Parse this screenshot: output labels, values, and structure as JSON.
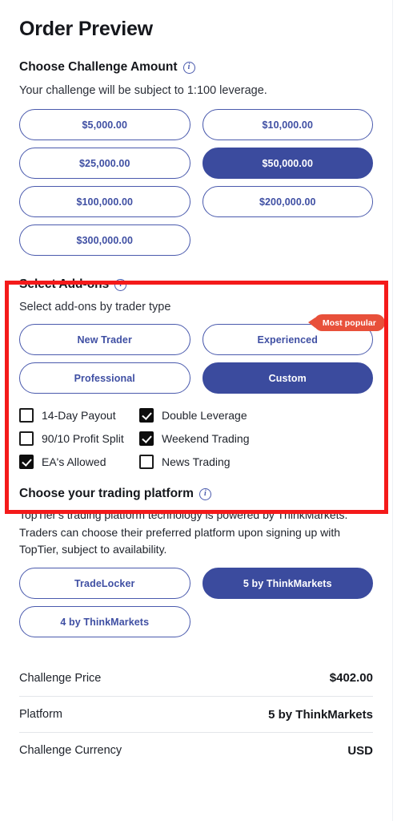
{
  "page": {
    "title": "Order Preview"
  },
  "challenge_amount": {
    "heading": "Choose Challenge Amount",
    "info_icon": "info-icon",
    "subtitle": "Your challenge will be subject to 1:100 leverage.",
    "options": [
      {
        "label": "$5,000.00",
        "selected": false
      },
      {
        "label": "$10,000.00",
        "selected": false
      },
      {
        "label": "$25,000.00",
        "selected": false
      },
      {
        "label": "$50,000.00",
        "selected": true
      },
      {
        "label": "$100,000.00",
        "selected": false
      },
      {
        "label": "$200,000.00",
        "selected": false
      },
      {
        "label": "$300,000.00",
        "selected": false
      }
    ]
  },
  "addons": {
    "heading": "Select Add-ons",
    "info_icon": "info-icon",
    "subtitle": "Select add-ons by trader type",
    "badge_label": "Most popular",
    "trader_types": [
      {
        "label": "New Trader",
        "selected": false,
        "badge": false
      },
      {
        "label": "Experienced",
        "selected": false,
        "badge": true
      },
      {
        "label": "Professional",
        "selected": false,
        "badge": false
      },
      {
        "label": "Custom",
        "selected": true,
        "badge": false
      }
    ],
    "checkboxes": [
      {
        "label": "14-Day Payout",
        "checked": false
      },
      {
        "label": "Double Leverage",
        "checked": true
      },
      {
        "label": "90/10 Profit Split",
        "checked": false
      },
      {
        "label": "Weekend Trading",
        "checked": true
      },
      {
        "label": "EA's Allowed",
        "checked": true
      },
      {
        "label": "News Trading",
        "checked": false
      }
    ]
  },
  "platform": {
    "heading": "Choose your trading platform",
    "info_icon": "info-icon",
    "description": "TopTier's trading platform technology is powered by ThinkMarkets. Traders can choose their preferred platform upon signing up with TopTier, subject to availability.",
    "options": [
      {
        "label": "TradeLocker",
        "selected": false
      },
      {
        "label": "5 by ThinkMarkets",
        "selected": true
      },
      {
        "label": "4 by ThinkMarkets",
        "selected": false
      }
    ]
  },
  "summary": {
    "rows": [
      {
        "label": "Challenge Price",
        "value": "$402.00"
      },
      {
        "label": "Platform",
        "value": "5 by ThinkMarkets"
      },
      {
        "label": "Challenge Currency",
        "value": "USD"
      }
    ]
  },
  "colors": {
    "brand_blue": "#3b4b9e",
    "border_blue": "#4a5aad",
    "badge_red": "#e8503a",
    "highlight_red": "#f41a1a"
  }
}
